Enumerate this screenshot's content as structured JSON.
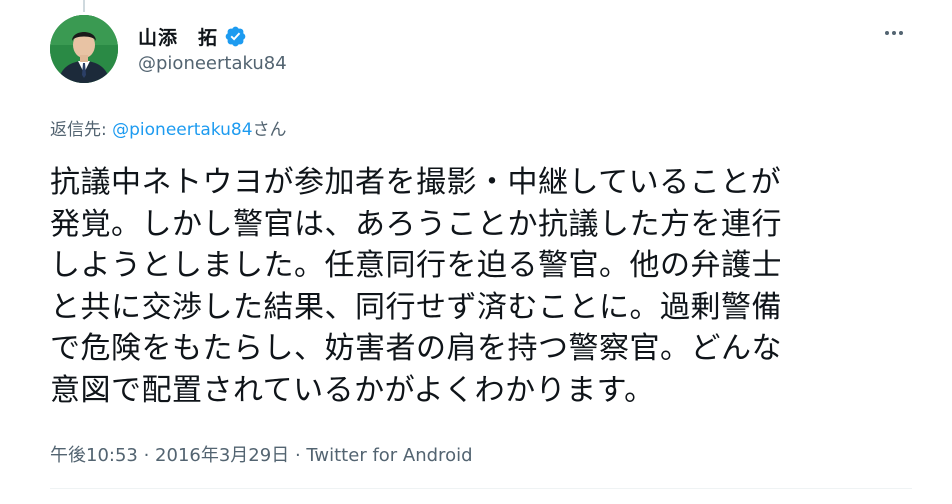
{
  "tweet": {
    "author": {
      "display_name": "山添　拓",
      "handle": "@pioneertaku84",
      "verified": true,
      "avatar_icon": "profile-photo",
      "verified_icon": "verified-badge-icon"
    },
    "reply_to": {
      "prefix": "返信先: ",
      "mention": "@pioneertaku84",
      "suffix": "さん"
    },
    "text_lines": [
      "抗議中ネトウヨが参加者を撮影・中継していることが",
      "発覚。しかし警官は、あろうことか抗議した方を連行",
      "しようとしました。任意同行を迫る警官。他の弁護士",
      "と共に交渉した結果、同行せず済むことに。過剰警備",
      "で危険をもたらし、妨害者の肩を持つ警察官。どんな",
      "意図で配置されているかがよくわかります。"
    ],
    "meta": {
      "time": "午後10:53",
      "separator": " · ",
      "date": "2016年3月29日",
      "source": "Twitter for Android"
    }
  },
  "colors": {
    "text": "#0f1419",
    "secondary": "#536471",
    "accent": "#1d9bf0",
    "divider": "#eff3f4"
  }
}
